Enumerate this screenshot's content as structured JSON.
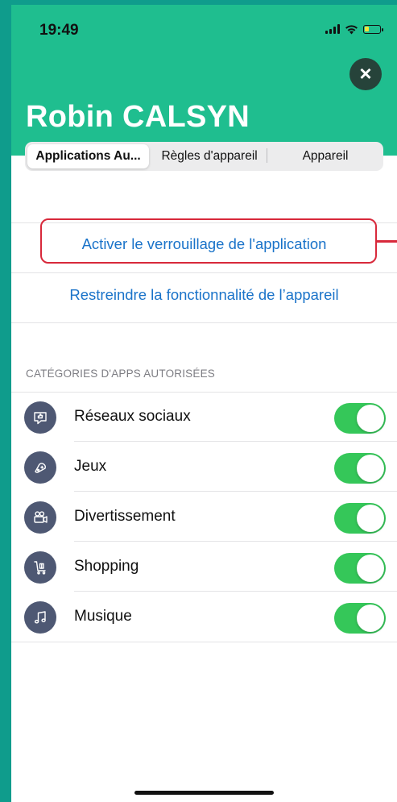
{
  "status_bar": {
    "time": "19:49"
  },
  "header": {
    "title": "Robin CALSYN",
    "close_label": "×"
  },
  "tabs": [
    {
      "label": "Applications Au..."
    },
    {
      "label": "Règles d'appareil"
    },
    {
      "label": "Appareil"
    }
  ],
  "actions": {
    "lock_app": "Activer le verrouillage de l'application",
    "restrict_device": "Restreindre la fonctionnalité de l’appareil"
  },
  "categories": {
    "section_title": "CATÉGORIES D'APPS AUTORISÉES",
    "items": [
      {
        "label": "Réseaux sociaux",
        "icon": "social-icon",
        "enabled": true
      },
      {
        "label": "Jeux",
        "icon": "gamepad-icon",
        "enabled": true
      },
      {
        "label": "Divertissement",
        "icon": "video-camera-icon",
        "enabled": true
      },
      {
        "label": "Shopping",
        "icon": "shopping-cart-icon",
        "enabled": true
      },
      {
        "label": "Musique",
        "icon": "music-note-icon",
        "enabled": true
      }
    ]
  },
  "colors": {
    "header_bg": "#1fbe8f",
    "accent_link": "#1a73c9",
    "toggle_on": "#35c759",
    "highlight": "#d8293b",
    "icon_bg": "#4e5873"
  }
}
